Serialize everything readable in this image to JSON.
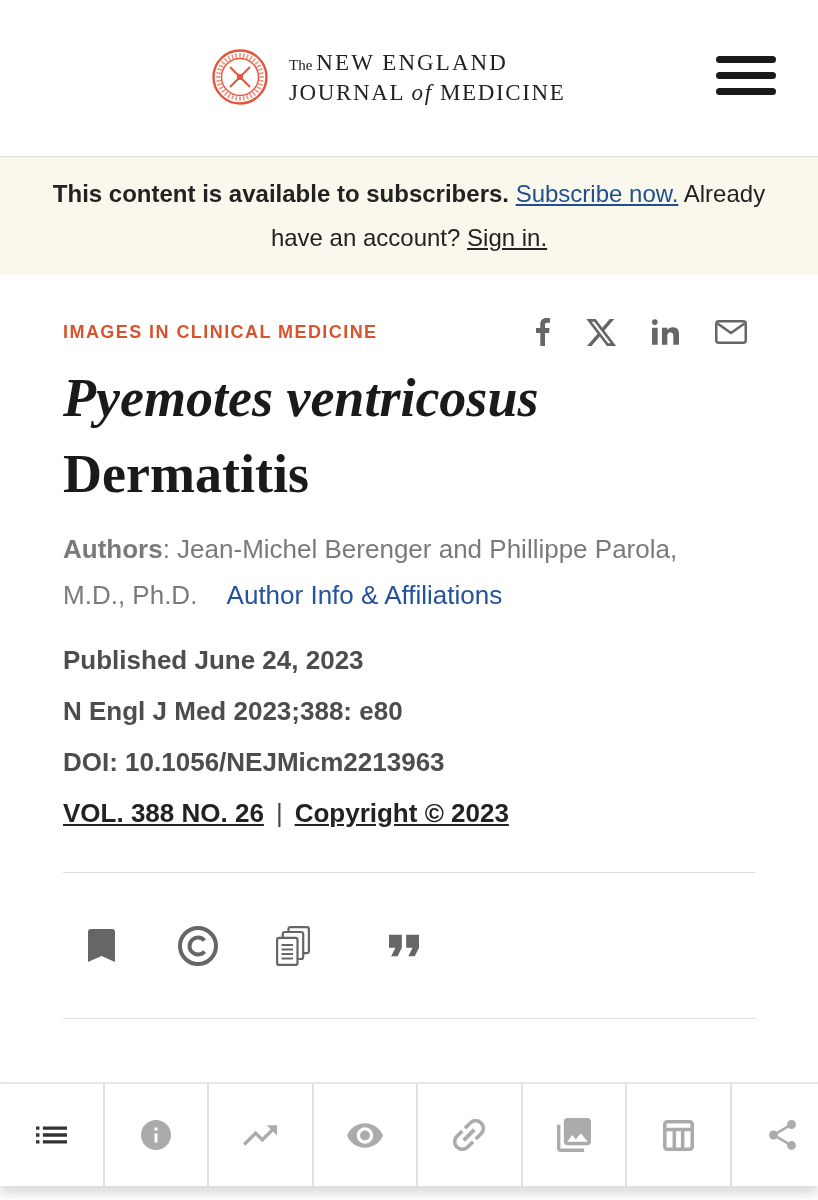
{
  "header": {
    "logo": {
      "prefix": "The",
      "line_1": "NEW ENGLAND",
      "line_2": "JOURNAL *of* MEDICINE"
    }
  },
  "notice": {
    "message": "This content is available to subscribers.",
    "subscribe_link": "Subscribe now.",
    "prompt": "Already have an account?",
    "sign_in_link": "Sign in."
  },
  "article": {
    "section": "IMAGES IN CLINICAL MEDICINE",
    "title": "*Pyemotes ventricosus* Dermatitis",
    "authors": "**Authors**: Jean-Michel Berenger and Phillippe Parola, M.D., Ph.D.",
    "author_info_link": "Author Info & Affiliations",
    "published": "Published June 24, 2023",
    "citation": "N Engl J Med 2023;388: e80",
    "doi": "DOI: 10.1056/NEJMicm2213963",
    "issue_link": "VOL. 388 NO. 26",
    "separator": "|",
    "copyright_link": "Copyright © 2023"
  },
  "bottom_toolbar": {
    "tabs": [
      {
        "kind": "contents",
        "selected": true
      },
      {
        "kind": "info",
        "selected": false
      },
      {
        "kind": "metrics",
        "selected": false
      },
      {
        "kind": "views",
        "selected": false
      },
      {
        "kind": "link",
        "selected": false
      },
      {
        "kind": "figures",
        "selected": false
      },
      {
        "kind": "tables",
        "selected": false
      },
      {
        "kind": "share",
        "selected": false
      }
    ]
  }
}
